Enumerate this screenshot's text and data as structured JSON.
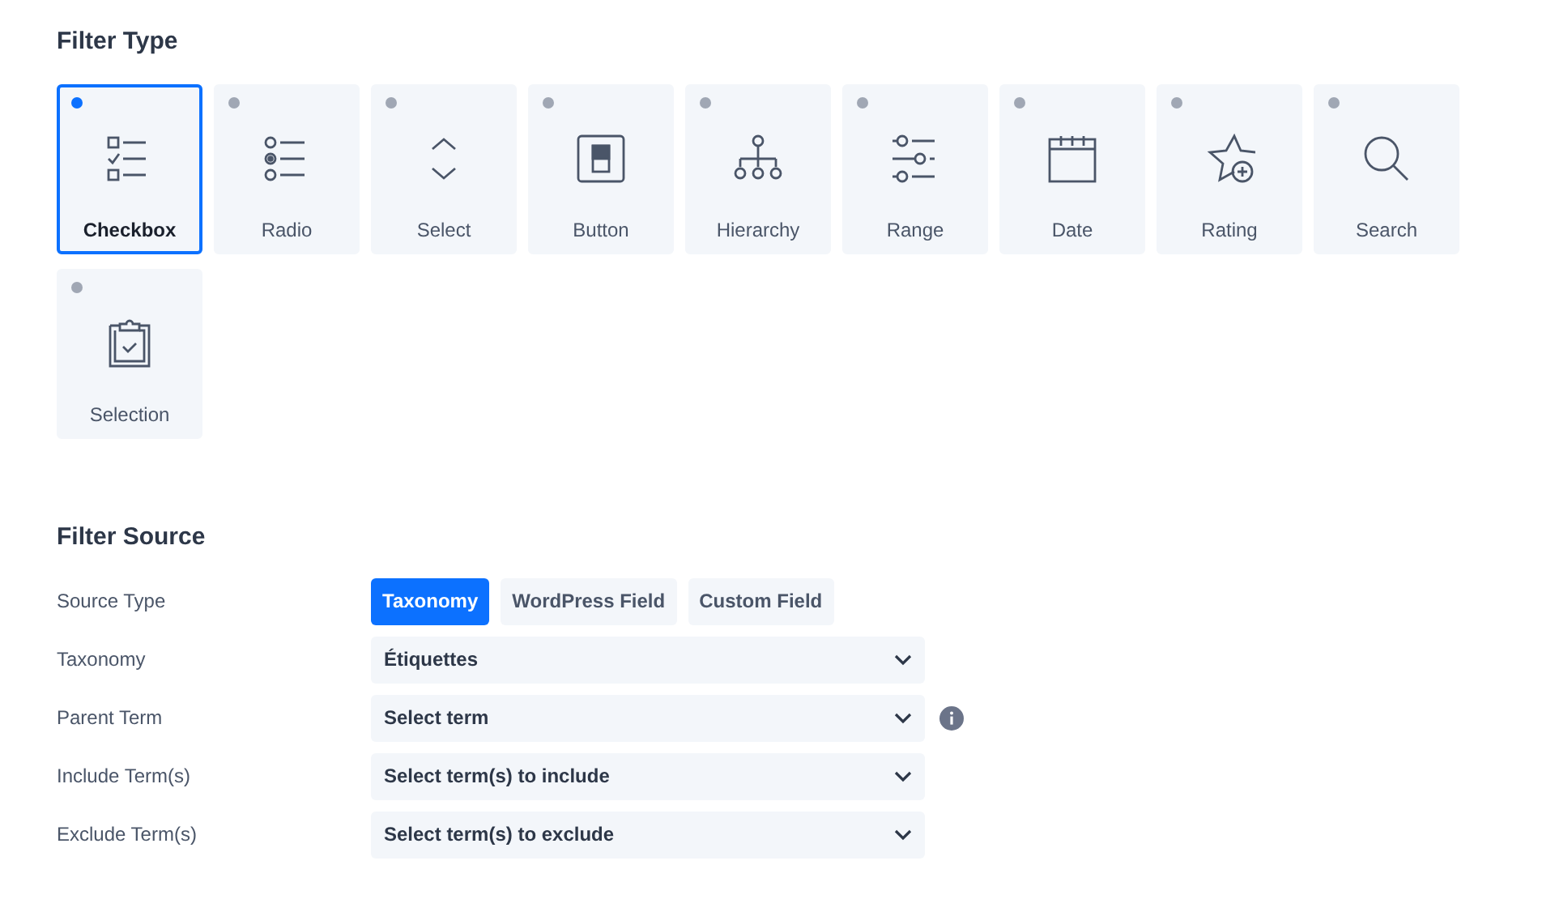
{
  "filter_type": {
    "title": "Filter Type",
    "tiles": [
      {
        "kind": "checkbox",
        "label": "Checkbox",
        "selected": true
      },
      {
        "kind": "radio",
        "label": "Radio",
        "selected": false
      },
      {
        "kind": "select",
        "label": "Select",
        "selected": false
      },
      {
        "kind": "button",
        "label": "Button",
        "selected": false
      },
      {
        "kind": "hierarchy",
        "label": "Hierarchy",
        "selected": false
      },
      {
        "kind": "range",
        "label": "Range",
        "selected": false
      },
      {
        "kind": "date",
        "label": "Date",
        "selected": false
      },
      {
        "kind": "rating",
        "label": "Rating",
        "selected": false
      },
      {
        "kind": "search",
        "label": "Search",
        "selected": false
      },
      {
        "kind": "selection",
        "label": "Selection",
        "selected": false
      }
    ]
  },
  "filter_source": {
    "title": "Filter Source",
    "rows": [
      {
        "kind": "segmented",
        "label": "Source Type",
        "options": [
          {
            "label": "Taxonomy",
            "selected": true
          },
          {
            "label": "WordPress Field",
            "selected": false
          },
          {
            "label": "Custom Field",
            "selected": false
          }
        ]
      },
      {
        "kind": "dropdown",
        "label": "Taxonomy",
        "value": "Étiquettes",
        "info": false
      },
      {
        "kind": "dropdown",
        "label": "Parent Term",
        "placeholder": "Select term",
        "info": true
      },
      {
        "kind": "dropdown",
        "label": "Include Term(s)",
        "placeholder": "Select term(s) to include",
        "info": false
      },
      {
        "kind": "dropdown",
        "label": "Exclude Term(s)",
        "placeholder": "Select term(s) to exclude",
        "info": false
      }
    ]
  }
}
